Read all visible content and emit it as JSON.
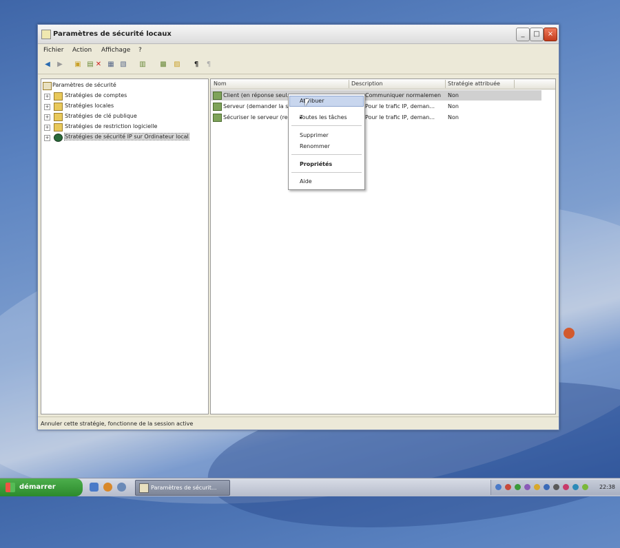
{
  "window": {
    "title": "Paramètres de sécurité locaux",
    "controls": [
      "_",
      "□",
      "×"
    ]
  },
  "menu": [
    "Fichier",
    "Action",
    "Affichage",
    "?"
  ],
  "toolbar_icons": [
    "back-icon",
    "forward-icon",
    "up-folder-icon",
    "show-hide-tree-icon",
    "delete-icon",
    "properties-icon",
    "refresh-icon",
    "export-list-icon",
    "help-icon",
    "new-policy-icon",
    "manage-filters-icon",
    "assign-icon",
    "unassign-icon"
  ],
  "tree": {
    "root": "Paramètres de sécurité",
    "items": [
      "Stratégies de comptes",
      "Stratégies locales",
      "Stratégies de clé publique",
      "Stratégies de restriction logicielle",
      "Stratégies de sécurité IP sur Ordinateur local"
    ]
  },
  "list": {
    "columns": [
      "Nom",
      "Description",
      "Stratégie attribuée"
    ],
    "rows": [
      {
        "name": "Client (en réponse seul...",
        "description": "Communiquer normalement ...",
        "assigned": "Non"
      },
      {
        "name": "Serveur (demander la s...",
        "description": "Pour le trafic IP, deman...",
        "assigned": "Non"
      },
      {
        "name": "Sécuriser le serveur (re...",
        "description": "Pour le trafic IP, deman...",
        "assigned": "Non"
      }
    ]
  },
  "context_menu": {
    "items": [
      "Attribuer",
      "Toutes les tâches",
      "Supprimer",
      "Renommer",
      "Propriétés",
      "Aide"
    ]
  },
  "status_text": "Annuler cette stratégie, fonctionne de la session active",
  "taskbar": {
    "start_label": "démarrer",
    "task_button": "Paramètres de sécurit...",
    "clock": "22:38"
  }
}
